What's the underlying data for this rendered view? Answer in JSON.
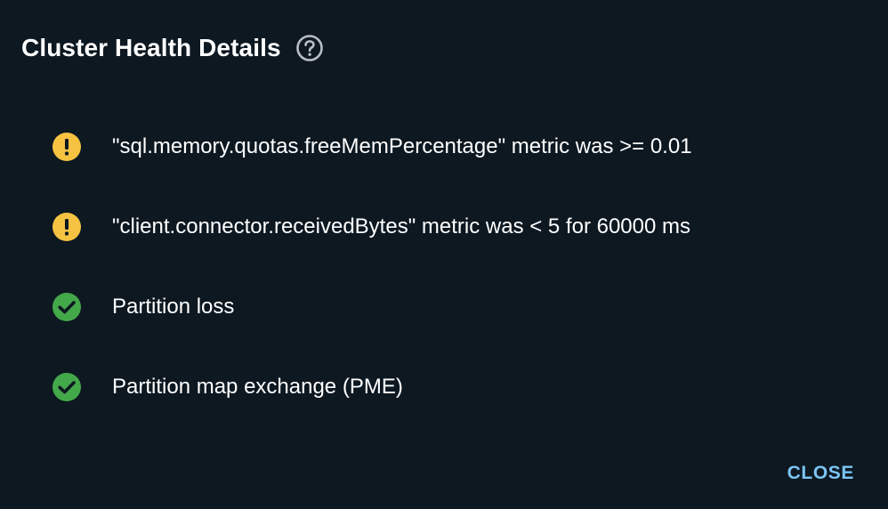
{
  "dialog": {
    "title": "Cluster Health Details",
    "help_icon": "help-circle-icon",
    "items": [
      {
        "status": "warning",
        "icon": "warning-icon",
        "text": "\"sql.memory.quotas.freeMemPercentage\" metric was >= 0.01"
      },
      {
        "status": "warning",
        "icon": "warning-icon",
        "text": "\"client.connector.receivedBytes\" metric was < 5 for 60000 ms"
      },
      {
        "status": "ok",
        "icon": "check-icon",
        "text": "Partition loss"
      },
      {
        "status": "ok",
        "icon": "check-icon",
        "text": "Partition map exchange (PME)"
      }
    ],
    "close_label": "CLOSE"
  },
  "colors": {
    "background": "#0d1821",
    "warning": "#f5c242",
    "ok": "#43a84a",
    "accent": "#7cc4f4",
    "text": "#ffffff"
  }
}
